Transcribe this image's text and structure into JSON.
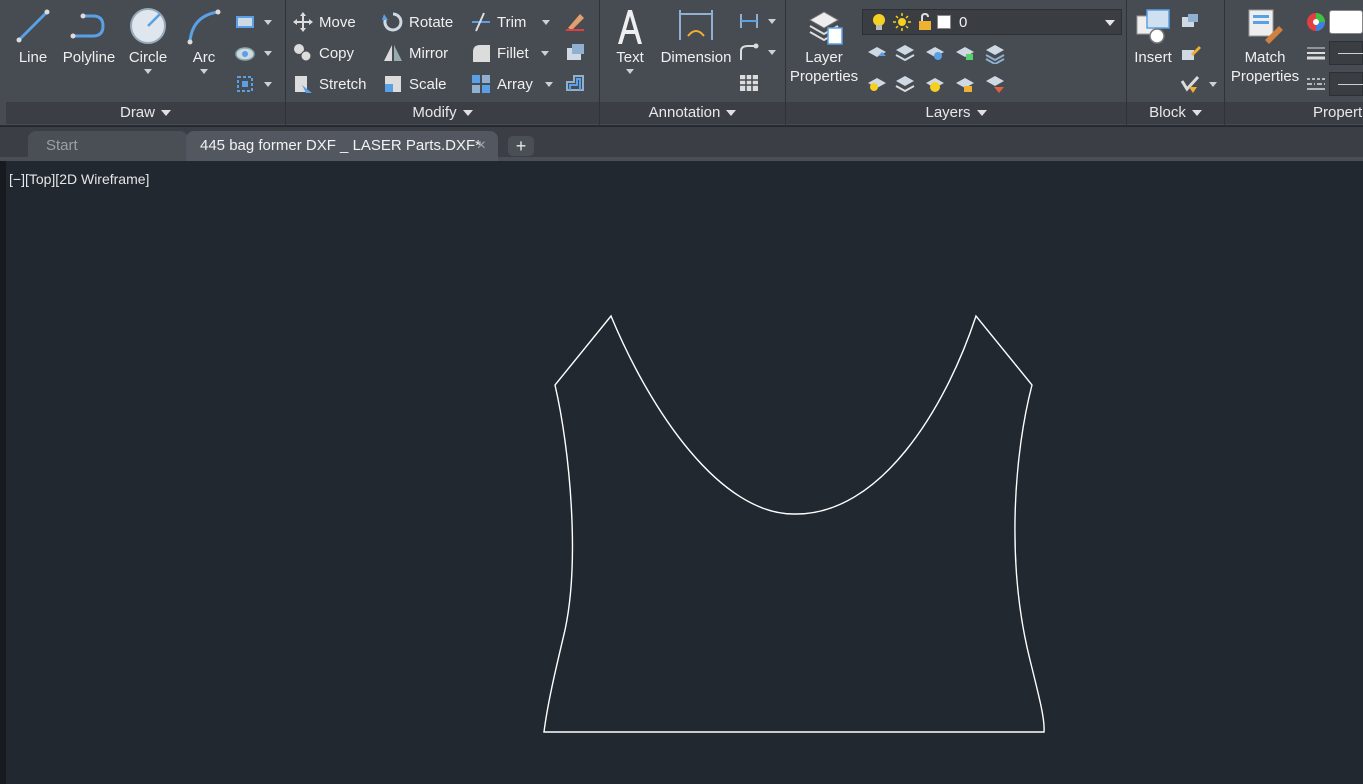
{
  "ribbon": {
    "draw": {
      "title": "Draw",
      "line": "Line",
      "polyline": "Polyline",
      "circle": "Circle",
      "arc": "Arc"
    },
    "modify": {
      "title": "Modify",
      "move": "Move",
      "rotate": "Rotate",
      "trim": "Trim",
      "copy": "Copy",
      "mirror": "Mirror",
      "fillet": "Fillet",
      "stretch": "Stretch",
      "scale": "Scale",
      "array": "Array"
    },
    "annotation": {
      "title": "Annotation",
      "text": "Text",
      "dimension": "Dimension"
    },
    "layers": {
      "title": "Layers",
      "layer_properties_line1": "Layer",
      "layer_properties_line2": "Properties",
      "current_layer": "0"
    },
    "block": {
      "title": "Block",
      "insert": "Insert"
    },
    "properties": {
      "title": "Propert",
      "match_line1": "Match",
      "match_line2": "Properties"
    }
  },
  "tabs": {
    "start": "Start",
    "drawing": "445 bag former DXF _ LASER Parts.DXF*",
    "close": "×",
    "new": "+"
  },
  "viewport": {
    "controls": "[−][Top][2D Wireframe]"
  },
  "colors": {
    "ribbon_bg": "#474b52",
    "canvas_bg": "#212830",
    "geometry": "#ffffff"
  }
}
